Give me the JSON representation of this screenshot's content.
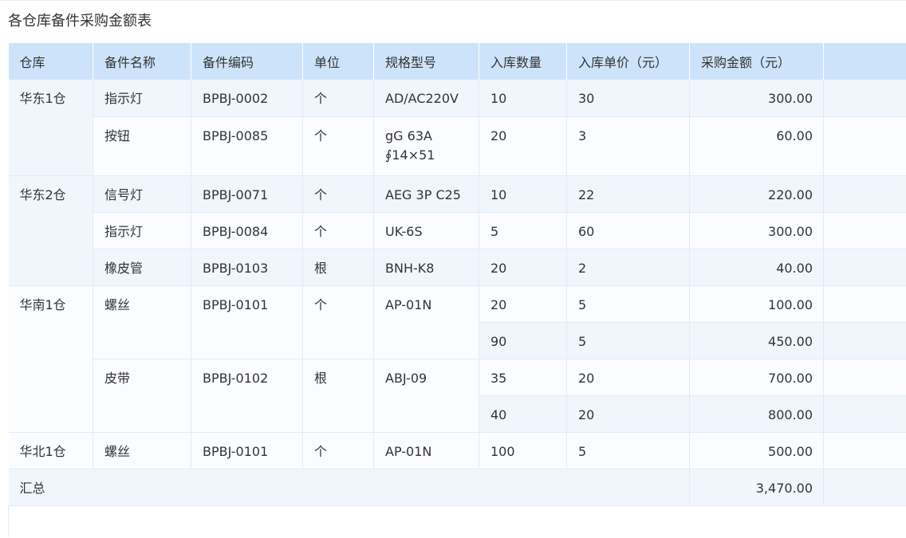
{
  "page_title": "各仓库备件采购金额表",
  "table": {
    "headers": [
      "仓库",
      "备件名称",
      "备件编码",
      "单位",
      "规格型号",
      "入库数量",
      "入库单价（元）",
      "采购金额（元）"
    ],
    "groups": [
      {
        "warehouse": "华东1仓",
        "items": [
          {
            "name": "指示灯",
            "code": "BPBJ-0002",
            "unit": "个",
            "spec": [
              "AD/AC220V"
            ],
            "entries": [
              {
                "qty": "10",
                "price": "30",
                "amount": "300.00"
              }
            ]
          },
          {
            "name": "按钮",
            "code": "BPBJ-0085",
            "unit": "个",
            "spec": [
              "gG 63A",
              "∮14×51"
            ],
            "entries": [
              {
                "qty": "20",
                "price": "3",
                "amount": "60.00"
              }
            ]
          }
        ]
      },
      {
        "warehouse": "华东2仓",
        "items": [
          {
            "name": "信号灯",
            "code": "BPBJ-0071",
            "unit": "个",
            "spec": [
              "AEG 3P C25"
            ],
            "entries": [
              {
                "qty": "10",
                "price": "22",
                "amount": "220.00"
              }
            ]
          },
          {
            "name": "指示灯",
            "code": "BPBJ-0084",
            "unit": "个",
            "spec": [
              "UK-6S"
            ],
            "entries": [
              {
                "qty": "5",
                "price": "60",
                "amount": "300.00"
              }
            ]
          },
          {
            "name": "橡皮管",
            "code": "BPBJ-0103",
            "unit": "根",
            "spec": [
              "BNH-K8"
            ],
            "entries": [
              {
                "qty": "20",
                "price": "2",
                "amount": "40.00"
              }
            ]
          }
        ]
      },
      {
        "warehouse": "华南1仓",
        "items": [
          {
            "name": "螺丝",
            "code": "BPBJ-0101",
            "unit": "个",
            "spec": [
              "AP-01N"
            ],
            "entries": [
              {
                "qty": "20",
                "price": "5",
                "amount": "100.00"
              },
              {
                "qty": "90",
                "price": "5",
                "amount": "450.00"
              }
            ]
          },
          {
            "name": "皮带",
            "code": "BPBJ-0102",
            "unit": "根",
            "spec": [
              "ABJ-09"
            ],
            "entries": [
              {
                "qty": "35",
                "price": "20",
                "amount": "700.00"
              },
              {
                "qty": "40",
                "price": "20",
                "amount": "800.00"
              }
            ]
          }
        ]
      },
      {
        "warehouse": "华北1仓",
        "items": [
          {
            "name": "螺丝",
            "code": "BPBJ-0101",
            "unit": "个",
            "spec": [
              "AP-01N"
            ],
            "entries": [
              {
                "qty": "100",
                "price": "5",
                "amount": "500.00"
              }
            ]
          }
        ]
      }
    ],
    "total": {
      "label": "汇总",
      "amount": "3,470.00"
    }
  },
  "colors": {
    "header_bg": "#cde3f9",
    "row_alt_bg": "#f0f6fc",
    "row_bg": "#fafcff",
    "grid_line": "#e1ebf5"
  }
}
